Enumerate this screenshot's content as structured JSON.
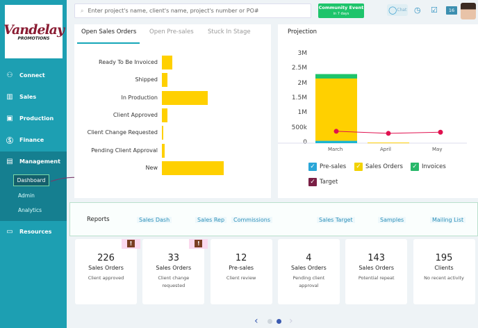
{
  "logo": {
    "line1": "Vandelay",
    "line2": "PROMOTIONS"
  },
  "sidebar": {
    "items": [
      {
        "label": "Connect",
        "icon": "users-icon"
      },
      {
        "label": "Sales",
        "icon": "bar-chart-icon"
      },
      {
        "label": "Production",
        "icon": "production-icon"
      },
      {
        "label": "Finance",
        "icon": "dollar-icon"
      },
      {
        "label": "Management",
        "icon": "building-icon"
      },
      {
        "label": "Resources",
        "icon": "book-icon"
      }
    ],
    "sub_items": [
      "Dashboard",
      "Admin",
      "Analytics"
    ]
  },
  "header": {
    "search_placeholder": "Enter project's name, client's name, project's number or PO#",
    "event_title": "Community Event",
    "event_sub": "in 7 days",
    "chat": "Chat",
    "notifications": "16"
  },
  "left_panel": {
    "tabs": [
      "Open Sales Orders",
      "Open Pre-sales",
      "Stuck In Stage"
    ],
    "active_tab": 0
  },
  "chart_data": [
    {
      "type": "bar",
      "orientation": "horizontal",
      "categories": [
        "Ready To Be Invoiced",
        "Shipped",
        "In Production",
        "Client Approved",
        "Client Change Requested",
        "Pending Client Approval",
        "New"
      ],
      "values": [
        15,
        8,
        66,
        8,
        2,
        4,
        89
      ],
      "color": "#ffd000"
    },
    {
      "type": "bar",
      "stacked": true,
      "title": "Projection",
      "categories": [
        "March",
        "April",
        "May"
      ],
      "yticks": [
        "0",
        "500k",
        "1M",
        "1.5M",
        "2M",
        "2.5M",
        "3M"
      ],
      "ylim": [
        0,
        3000000
      ],
      "series": [
        {
          "name": "Pre-sales",
          "values": [
            80000,
            0,
            0
          ],
          "color": "#1ab6d0"
        },
        {
          "name": "Sales Orders",
          "values": [
            2100000,
            20000,
            0
          ],
          "color": "#ffd000"
        },
        {
          "name": "Invoices",
          "values": [
            150000,
            0,
            0
          ],
          "color": "#1ec46b"
        },
        {
          "name": "Target",
          "type": "line",
          "values": [
            400000,
            330000,
            370000
          ],
          "color": "#e0114f"
        }
      ]
    }
  ],
  "legend_colors": {
    "Pre-sales": "#2aa6d8",
    "Sales Orders": "#f2d200",
    "Invoices": "#28b86a",
    "Target": "#7a1f45"
  },
  "reports": {
    "label": "Reports",
    "tabs": [
      "Sales Dash",
      "Sales Rep",
      "Commissions",
      "Sales Target",
      "Samples",
      "Mailing List"
    ]
  },
  "cards": [
    {
      "n": "226",
      "t": "Sales Orders",
      "s": "Client approved",
      "warn": true
    },
    {
      "n": "33",
      "t": "Sales Orders",
      "s": "Client change requested",
      "warn": true
    },
    {
      "n": "12",
      "t": "Pre-sales",
      "s": "Client review"
    },
    {
      "n": "4",
      "t": "Sales Orders",
      "s": "Pending client approval"
    },
    {
      "n": "143",
      "t": "Sales Orders",
      "s": "Potential repeat"
    },
    {
      "n": "195",
      "t": "Clients",
      "s": "No recent activity"
    }
  ],
  "pagination": {
    "pages": 2,
    "current": 2
  }
}
